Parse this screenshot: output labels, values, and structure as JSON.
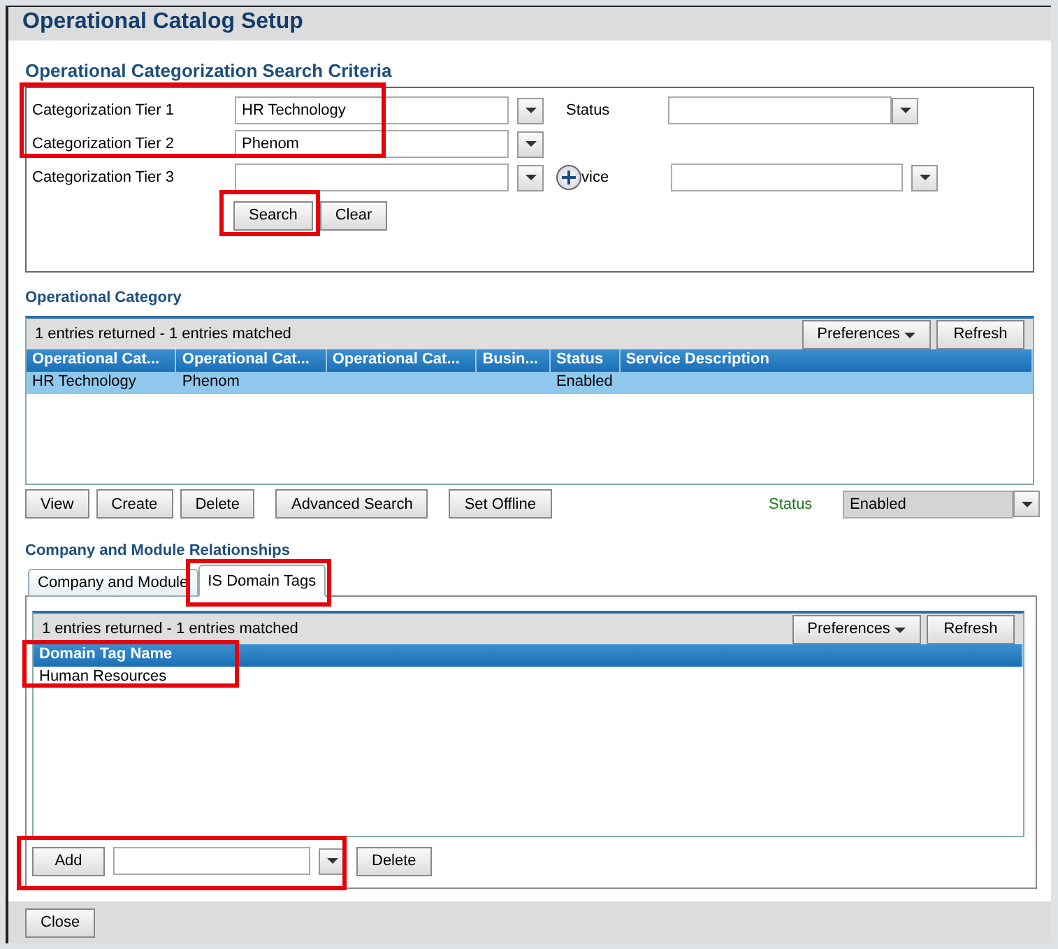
{
  "window": {
    "title": "Operational Catalog Setup"
  },
  "search_criteria": {
    "heading": "Operational Categorization Search Criteria",
    "fields": [
      {
        "label": "Categorization Tier 1",
        "value": "HR Technology"
      },
      {
        "label": "Categorization Tier 2",
        "value": "Phenom"
      },
      {
        "label": "Categorization Tier 3"
      }
    ],
    "status_label": "Status",
    "service_label": "vice",
    "buttons": [
      "Search",
      "Clear"
    ]
  },
  "operational_category": {
    "heading": "Operational Category",
    "summary": "1 entries returned - 1 entries matched",
    "preferences": "Preferences",
    "refresh": "Refresh",
    "columns": [
      "Operational Cat...",
      "Operational Cat...",
      "Operational Cat...",
      "Busin...",
      "Status",
      "Service Description"
    ],
    "rows": [
      {
        "cells": [
          "HR Technology",
          "Phenom",
          "",
          "",
          "Enabled",
          ""
        ],
        "selected": true
      }
    ],
    "buttons": [
      "View",
      "Create",
      "Delete",
      "Advanced Search",
      "Set Offline"
    ],
    "status_label": "Status",
    "status_value": "Enabled"
  },
  "relationships": {
    "heading": "Company and Module Relationships",
    "tabs": [
      {
        "label": "Company and Module",
        "selected": false
      },
      {
        "label": "IS Domain Tags",
        "selected": true
      }
    ],
    "summary": "1 entries returned - 1 entries matched",
    "preferences": "Preferences",
    "refresh": "Refresh",
    "columns": [
      "Domain Tag Name"
    ],
    "rows": [
      {
        "cells": [
          "Human Resources"
        ],
        "selected": false
      }
    ],
    "add": "Add",
    "delete": "Delete"
  },
  "footer": {
    "close": "Close"
  }
}
